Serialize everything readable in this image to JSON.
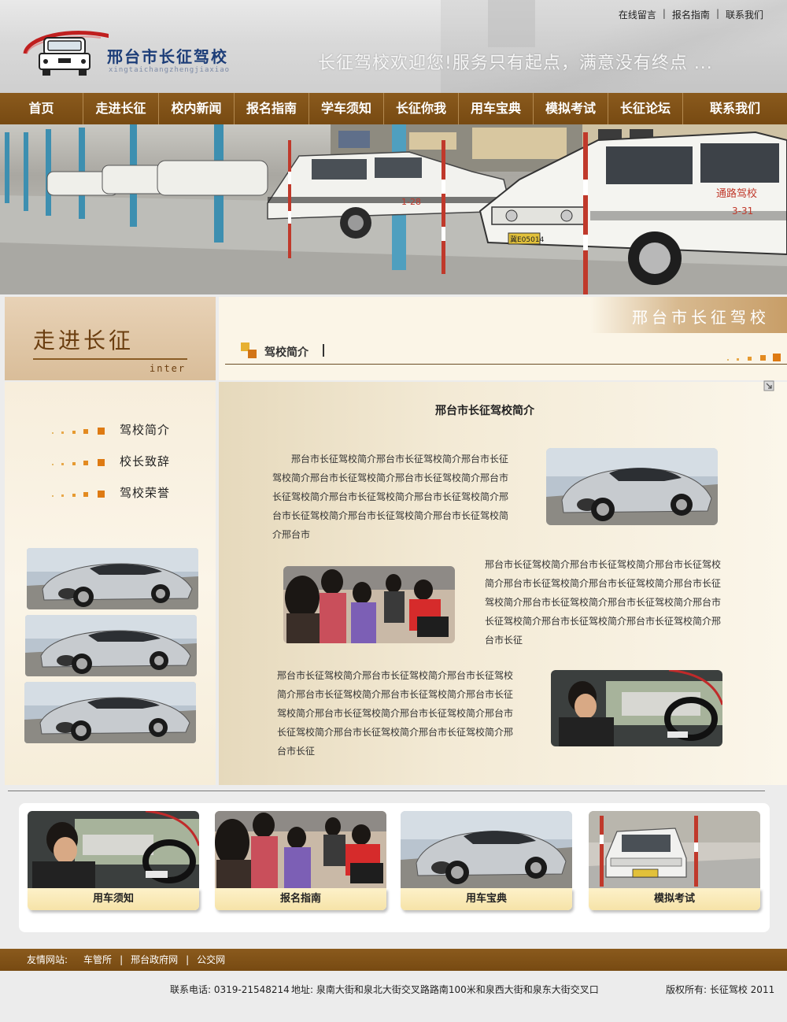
{
  "header": {
    "logo_title": "邢台市长征驾校",
    "logo_subtitle": "xingtaichangzhengjiaxiao",
    "slogan": "长征驾校欢迎您!服务只有起点，满意没有终点 ...",
    "top_links": [
      "在线留言",
      "报名指南",
      "联系我们"
    ]
  },
  "nav": {
    "items": [
      "首页",
      "走进长征",
      "校内新闻",
      "报名指南",
      "学车须知",
      "长征你我",
      "用车宝典",
      "模拟考试",
      "长征论坛",
      "联系我们"
    ]
  },
  "banner": {
    "sign_text_1": "通路驾校",
    "sign_text_2": "3-31",
    "plate_1": "冀E05014",
    "sign_text_3": "1-28"
  },
  "left": {
    "title_cn": "走进长征",
    "title_en": "inter",
    "menu": [
      "驾校简介",
      "校长致辞",
      "驾校荣誉"
    ]
  },
  "right": {
    "badge": "邢台市长征驾校",
    "section_title": "驾校简介",
    "article_title": "邢台市长征驾校简介",
    "para1": "　　邢台市长征驾校简介邢台市长征驾校简介邢台市长征驾校简介邢台市长征驾校简介邢台市长征驾校简介邢台市长征驾校简介邢台市长征驾校简介邢台市长征驾校简介邢台市长征驾校简介邢台市长征驾校简介邢台市长征驾校简介邢台市",
    "para2": "邢台市长征驾校简介邢台市长征驾校简介邢台市长征驾校简介邢台市长征驾校简介邢台市长征驾校简介邢台市长征驾校简介邢台市长征驾校简介邢台市长征驾校简介邢台市长征驾校简介邢台市长征驾校简介邢台市长征驾校简介邢台市长征",
    "para3": "邢台市长征驾校简介邢台市长征驾校简介邢台市长征驾校简介邢台市长征驾校简介邢台市长征驾校简介邢台市长征驾校简介邢台市长征驾校简介邢台市长征驾校简介邢台市长征驾校简介邢台市长征驾校简介邢台市长征驾校简介邢台市长征"
  },
  "cards": [
    "用车须知",
    "报名指南",
    "用车宝典",
    "模拟考试"
  ],
  "friends": {
    "label": "友情网站:",
    "links": [
      "车管所",
      "邢台政府网",
      "公交网"
    ]
  },
  "footer": {
    "phone": "联系电话: 0319-21548214",
    "address": "地址: 泉南大街和泉北大街交叉路路南100米和泉西大街和泉东大街交叉口",
    "copyright": "版权所有: 长征驾校 2011"
  },
  "colors": {
    "nav_brown": "#7d4f15",
    "accent_orange": "#e07b1a",
    "logo_blue": "#1c3d78"
  }
}
